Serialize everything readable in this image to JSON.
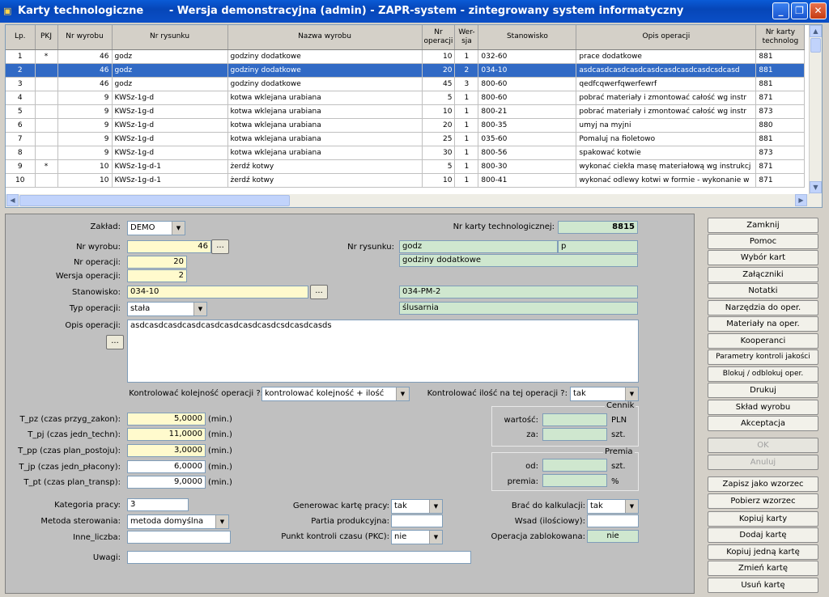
{
  "window": {
    "title": "Karty technologiczne       - Wersja demonstracyjna (admin) - ZAPR-system - zintegrowany system informatyczny"
  },
  "grid": {
    "columns": [
      "Lp.",
      "PKJ",
      "Nr wyrobu",
      "Nr rysunku",
      "Nazwa wyrobu",
      "Nr operacji",
      "Wer-sja",
      "Stanowisko",
      "Opis operacji",
      "Nr karty technolog"
    ],
    "rows": [
      [
        "1",
        "*",
        "46",
        "godz",
        "godziny dodatkowe",
        "10",
        "1",
        "032-60",
        "prace dodatkowe",
        "881"
      ],
      [
        "2",
        "",
        "46",
        "godz",
        "godziny dodatkowe",
        "20",
        "2",
        "034-10",
        "asdcasdcasdcasdcasdcasdcasdcasdcsdcasd",
        "881"
      ],
      [
        "3",
        "",
        "46",
        "godz",
        "godziny dodatkowe",
        "45",
        "3",
        "800-60",
        "qedfcqwerfqwerfewrf",
        "881"
      ],
      [
        "4",
        "",
        "9",
        "KWSz-1g-d",
        "kotwa wklejana urabiana",
        "5",
        "1",
        "800-60",
        "pobrać materiały i zmontować całość wg instr",
        "871"
      ],
      [
        "5",
        "",
        "9",
        "KWSz-1g-d",
        "kotwa wklejana urabiana",
        "10",
        "1",
        "800-21",
        "pobrać materiały i zmontować całość wg instr",
        "873"
      ],
      [
        "6",
        "",
        "9",
        "KWSz-1g-d",
        "kotwa wklejana urabiana",
        "20",
        "1",
        "800-35",
        "umyj na myjni",
        "880"
      ],
      [
        "7",
        "",
        "9",
        "KWSz-1g-d",
        "kotwa wklejana urabiana",
        "25",
        "1",
        "035-60",
        "Pomaluj na fioletowo",
        "881"
      ],
      [
        "8",
        "",
        "9",
        "KWSz-1g-d",
        "kotwa wklejana urabiana",
        "30",
        "1",
        "800-56",
        "spakować kotwie",
        "873"
      ],
      [
        "9",
        "*",
        "10",
        "KWSz-1g-d-1",
        "żerdź kotwy",
        "5",
        "1",
        "800-30",
        "wykonać ciekła masę materiałową wg instrukcj",
        "871"
      ],
      [
        "10",
        "",
        "10",
        "KWSz-1g-d-1",
        "żerdź kotwy",
        "10",
        "1",
        "800-41",
        "wykonać odlewy kotwi w formie  - wykonanie w",
        "871"
      ]
    ]
  },
  "form": {
    "zaklad_label": "Zakład:",
    "zaklad": "DEMO",
    "nr_karty_label": "Nr karty technologicznej:",
    "nr_karty": "8815",
    "nr_wyrobu_label": "Nr wyrobu:",
    "nr_wyrobu": "46",
    "nr_rysunku_label": "Nr rysunku:",
    "nr_rysunku": "godz",
    "nr_rysunku_suffix": "p",
    "nazwa_wyrobu": "godziny dodatkowe",
    "nr_operacji_label": "Nr operacji:",
    "nr_operacji": "20",
    "wersja_label": "Wersja operacji:",
    "wersja": "2",
    "stanowisko_label": "Stanowisko:",
    "stanowisko": "034-10",
    "stanowisko_kod": "034-PM-2",
    "stanowisko_nazwa": "ślusarnia",
    "typ_label": "Typ operacji:",
    "typ": "stała",
    "opis_label": "Opis operacji:",
    "opis": "asdcasdcasdcasdcasdcasdcasdcasdcsdcasdcasds",
    "ellipsis": "...",
    "kontrol_kol_label": "Kontrolować kolejność operacji ?:",
    "kontrol_kol": "kontrolować kolejność + ilość",
    "kontrol_il_label": "Kontrolować ilość na tej operacji ?:",
    "kontrol_il": "tak",
    "tpz_label": "T_pz (czas przyg_zakon):",
    "tpz": "5,0000",
    "tpj_label": "T_pj (czas jedn_techn):",
    "tpj": "11,0000",
    "tpp_label": "T_pp (czas plan_postoju):",
    "tpp": "3,0000",
    "tjp_label": "T_jp (czas jedn_płacony):",
    "tjp": "6,0000",
    "tpt_label": "T_pt (czas plan_transp):",
    "tpt": "9,0000",
    "min_unit": "(min.)",
    "cennik_title": "Cennik",
    "wartosc_label": "wartość:",
    "za_label": "za:",
    "pln": "PLN",
    "szt": "szt.",
    "premia_title": "Premia",
    "od_label": "od:",
    "premia_label": "premia:",
    "pct": "%",
    "kategoria_label": "Kategoria pracy:",
    "kategoria": "3",
    "metoda_label": "Metoda sterowania:",
    "metoda": "metoda domyślna",
    "inne_label": "Inne_liczba:",
    "inne": "",
    "uwagi_label": "Uwagi:",
    "uwagi": "",
    "generowac_label": "Generowac kartę pracy:",
    "generowac": "tak",
    "partia_label": "Partia produkcyjna:",
    "partia": "",
    "pkc_label": "Punkt kontroli czasu (PKC):",
    "pkc": "nie",
    "brac_label": "Brać do kalkulacji:",
    "brac": "tak",
    "wsad_label": "Wsad (ilościowy):",
    "wsad": "",
    "zablokowana_label": "Operacja zablokowana:",
    "zablokowana": "nie"
  },
  "buttons": [
    "Zamknij",
    "Pomoc",
    "Wybór kart",
    "Załączniki",
    "Notatki",
    "Narzędzia do oper.",
    "Materiały na oper.",
    "Kooperanci",
    "Parametry kontroli jakości",
    "Blokuj / odblokuj oper.",
    "Drukuj",
    "Skład wyrobu",
    "Akceptacja",
    "OK",
    "Anuluj",
    "Zapisz jako wzorzec",
    "Pobierz wzorzec",
    "Kopiuj karty",
    "Dodaj kartę",
    "Kopiuj jedną kartę",
    "Zmień kartę",
    "Usuń kartę"
  ]
}
